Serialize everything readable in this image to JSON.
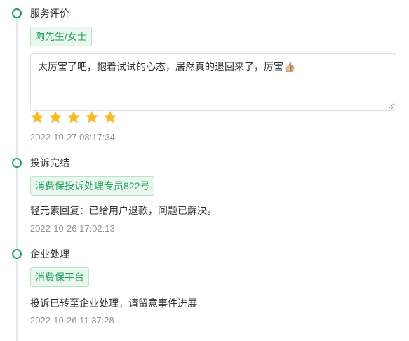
{
  "timeline": [
    {
      "title": "服务评价",
      "tag": "陶先生/女士",
      "comment": "太厉害了吧，抱着试试的心态，居然真的退回来了，厉害👍🏼",
      "rating": 5,
      "rating_max": 5,
      "time": "2022-10-27 08:17:34"
    },
    {
      "title": "投诉完结",
      "tag": "消费保投诉处理专员822号",
      "text": "轻元素回复：已给用户退款，问题已解决。",
      "time": "2022-10-26 17:02:13"
    },
    {
      "title": "企业处理",
      "tag": "消费保平台",
      "text": "投诉已转至企业处理，请留意事件进展",
      "time": "2022-10-26 11:37:28"
    }
  ],
  "colors": {
    "accent": "#22a15f",
    "tag_bg": "#eaf7ef",
    "star": "#f7ba2a",
    "muted": "#909399"
  }
}
